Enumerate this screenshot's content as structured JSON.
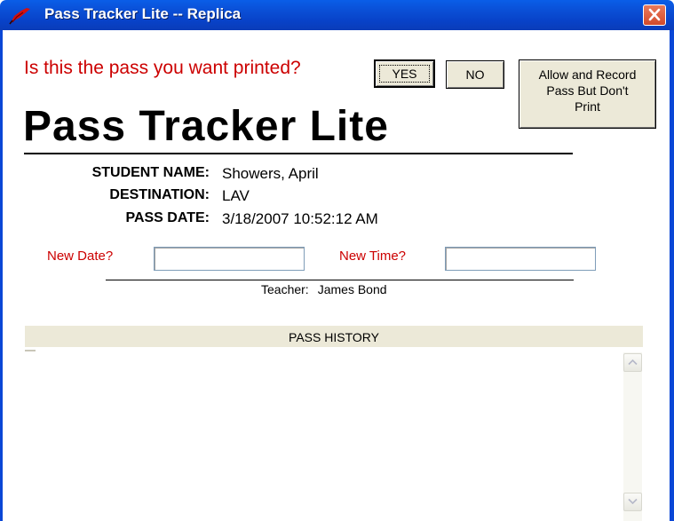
{
  "window": {
    "title": "Pass Tracker Lite -- Replica",
    "icon": "red-pen-icon",
    "close_icon": "close-icon",
    "frame_color": "#0a47d6"
  },
  "prompt": {
    "question": "Is this the pass you want printed?",
    "color": "#cc0000"
  },
  "buttons": {
    "yes": "YES",
    "no": "NO",
    "allow_line1": "Allow and Record",
    "allow_line2": "Pass But Don't",
    "allow_line3": "Print"
  },
  "brand": "Pass Tracker Lite",
  "pass": {
    "student_label": "STUDENT NAME:",
    "student_value": "Showers, April",
    "destination_label": "DESTINATION:",
    "destination_value": "LAV",
    "date_label": "PASS DATE:",
    "date_value": "3/18/2007 10:52:12 AM"
  },
  "inputs": {
    "new_date_label": "New Date?",
    "new_date_value": "",
    "new_time_label": "New Time?",
    "new_time_value": ""
  },
  "teacher": {
    "label": "Teacher:",
    "name": "James Bond"
  },
  "history": {
    "header": "PASS HISTORY",
    "items": []
  }
}
